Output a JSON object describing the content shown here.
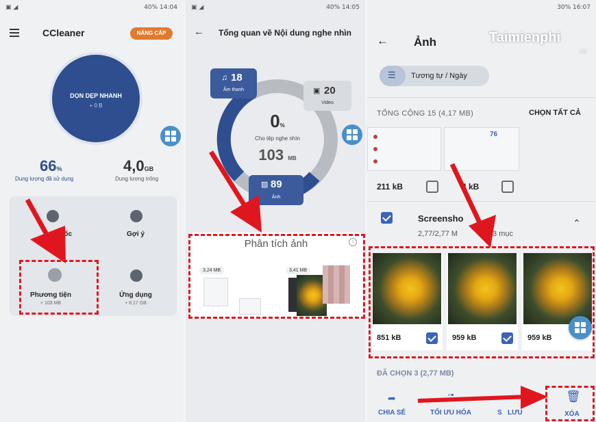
{
  "panel1": {
    "status_time": "40% 14:04",
    "app_title": "CCleaner",
    "upgrade_badge": "NÂNG CẤP",
    "circle_title": "DỌN DẸP NHANH",
    "circle_sub": "+ 0 B",
    "used_value": "66",
    "used_unit": "%",
    "used_label": "Dung lượng đã sử dụng",
    "free_value": "4,0",
    "free_unit": "GB",
    "free_label": "Dung lượng trống",
    "tile_speed_label": "tốc",
    "tile_suggest_label": "Gợi ý",
    "tile_media_label": "Phương tiện",
    "tile_media_sub": "+ 103 MB",
    "tile_apps_label": "Ứng dụng",
    "tile_apps_sub": "+ 8,17 GB"
  },
  "panel2": {
    "status_time": "40% 14:05",
    "title": "Tổng quan về Nội dung nghe nhìn",
    "audio_value": "18",
    "audio_label": "Âm thanh",
    "video_value": "20",
    "video_label": "Video",
    "center_percent": "0",
    "center_percent_unit": "%",
    "center_label": "Cho tệp nghe nhìn",
    "center_size": "103",
    "center_size_unit": "MB",
    "photo_value": "89",
    "photo_label": "Ảnh",
    "analysis_title": "Phân tích ảnh",
    "size_a": "3,24 MB",
    "size_b": "3,41 MB"
  },
  "panel3": {
    "status_time": "30% 16:07",
    "title": "Ảnh",
    "watermark": "Taimienphi",
    "watermark_sub": ".vn",
    "filter_label": "Tương tự / Ngày",
    "total_label": "TỔNG CỘNG 15 (4,17 MB)",
    "select_all": "CHỌN TẤT CẢ",
    "size_top_1": "211 kB",
    "size_top_2": "4 kB",
    "group_title": "Screensho",
    "group_sub_a": "2,77/2,77 M",
    "group_sub_b": "/3 mục",
    "thumb_sizes": [
      "851 kB",
      "959 kB",
      "959 kB"
    ],
    "selected_label": "ĐÃ CHỌN 3 (2,77 MB)",
    "action_share": "CHIA SẺ",
    "action_optimize": "TỐI ƯU HÓA",
    "action_backup": "S   LƯU",
    "action_delete": "XÓA",
    "mini_76": "76"
  },
  "colors": {
    "primary_blue": "#2e4e8f",
    "accent_orange": "#e07a2e",
    "fab_blue": "#4a90c8",
    "red_highlight": "#e0161e",
    "grey_ring": "#b7bcc3"
  }
}
